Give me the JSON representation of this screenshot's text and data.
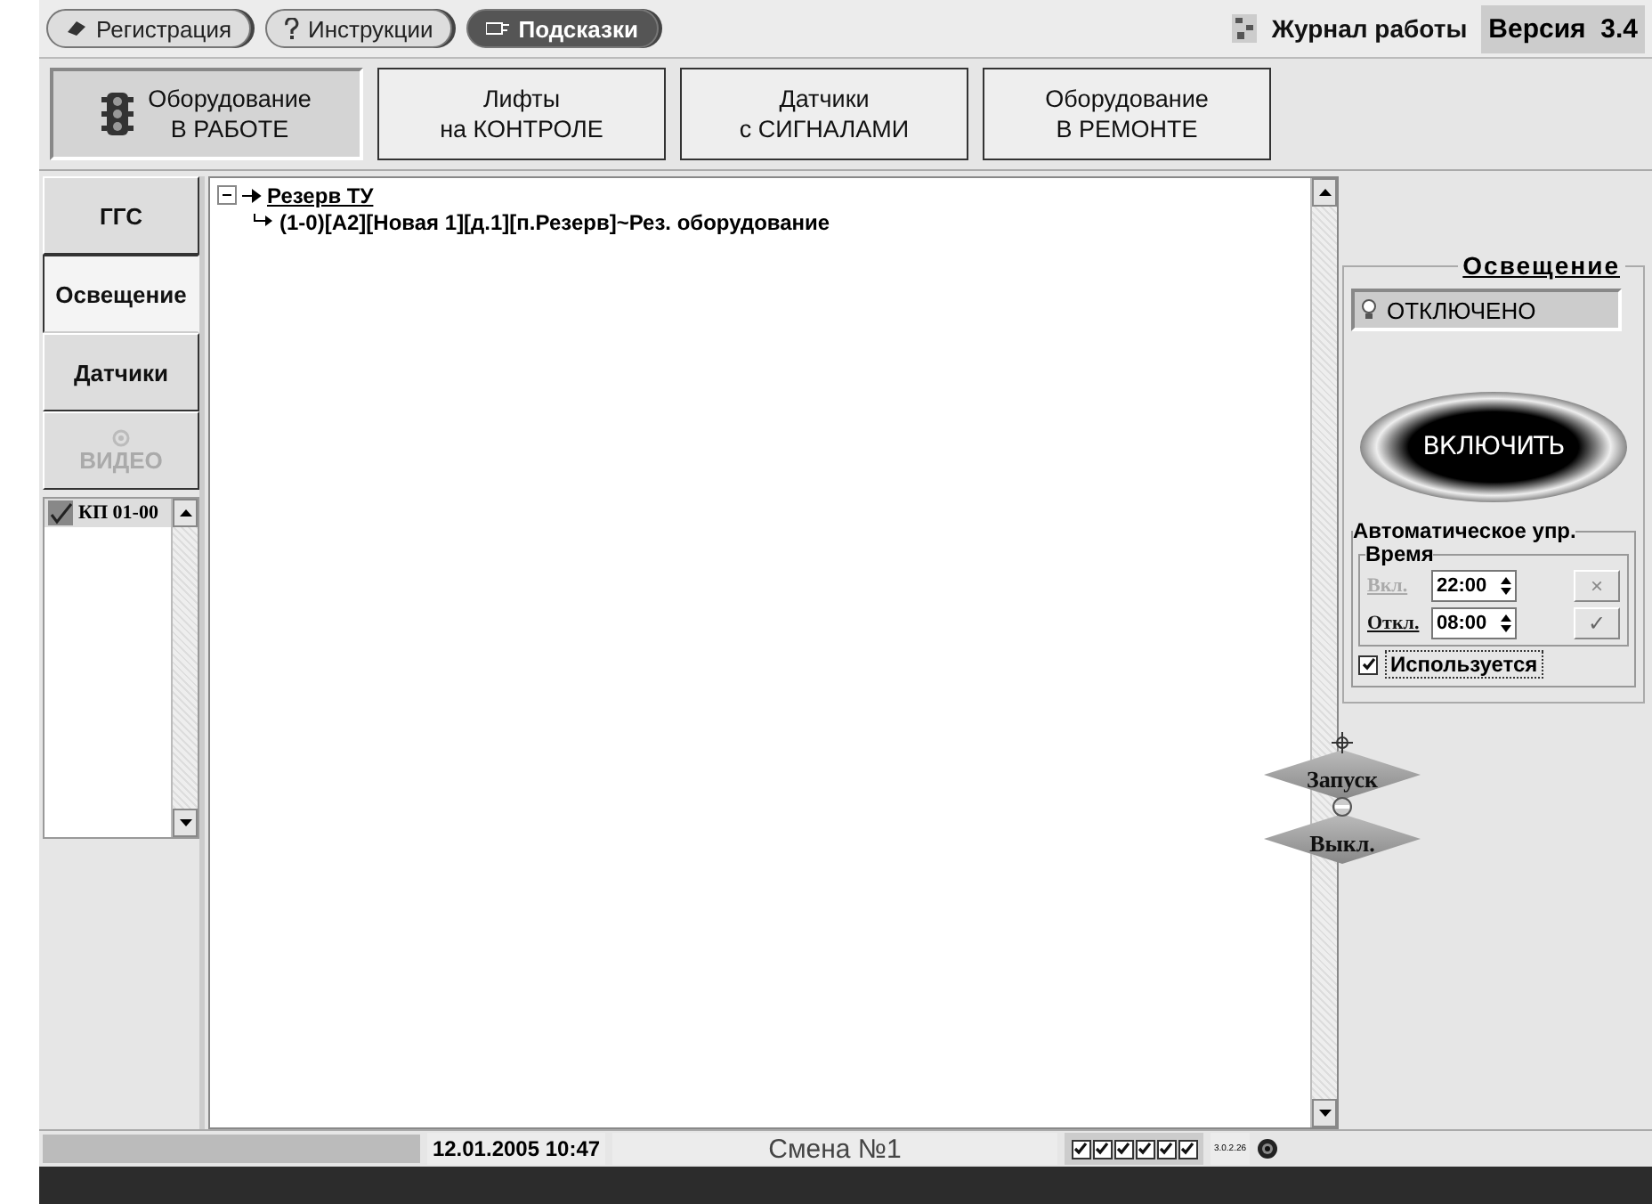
{
  "top_bar": {
    "buttons": [
      {
        "label": "Регистрация",
        "kind": "register",
        "selected": false
      },
      {
        "label": "Инструкции",
        "kind": "help",
        "selected": false
      },
      {
        "label": "Подсказки",
        "kind": "hints",
        "selected": true
      }
    ],
    "journal": "Журнал работы",
    "version": "Версия  3.4"
  },
  "nav": [
    {
      "lines": [
        "Оборудование",
        "В РАБОТЕ"
      ],
      "selected": true
    },
    {
      "lines": [
        "Лифты",
        "на КОНТРОЛЕ"
      ],
      "selected": false
    },
    {
      "lines": [
        "Датчики",
        "с СИГНАЛАМИ"
      ],
      "selected": false
    },
    {
      "lines": [
        "Оборудование",
        "В РЕМОНТЕ"
      ],
      "selected": false
    }
  ],
  "side_tabs": [
    {
      "label": "ГГС",
      "selected": false,
      "disabled": false
    },
    {
      "label": "Освещение",
      "selected": true,
      "disabled": false
    },
    {
      "label": "Датчики",
      "selected": false,
      "disabled": false
    },
    {
      "label": "ВИДЕО",
      "selected": false,
      "disabled": true
    }
  ],
  "kp_list": [
    {
      "label": "КП 01-00",
      "checked": true
    }
  ],
  "tree": [
    {
      "label": "Резерв ТУ",
      "expanded": true,
      "children": [
        {
          "label": "(1-0)[А2][Новая 1][д.1][п.Резерв]~Рез. оборудование"
        }
      ]
    }
  ],
  "lighting": {
    "title": "Освещение",
    "status": "ОТКЛЮЧЕНО",
    "button": "ВКЛЮЧИТЬ",
    "auto": {
      "title": "Автоматическое упр.",
      "time_title": "Время",
      "rows": [
        {
          "label": "Вкл.",
          "value": "22:00",
          "disabled": true,
          "action": "×"
        },
        {
          "label": "Откл.",
          "value": "08:00",
          "disabled": false,
          "action": "✓"
        }
      ],
      "used": {
        "label": "Используется",
        "checked": true
      }
    }
  },
  "floating": [
    {
      "label": "Запуск",
      "kind": "start"
    },
    {
      "label": "Выкл.",
      "kind": "stop"
    }
  ],
  "status_bar": {
    "date": "12.01.2005 10:47",
    "shift": "Смена №1",
    "checks": [
      {
        "checked": true
      },
      {
        "checked": true
      },
      {
        "checked": true
      },
      {
        "checked": true
      },
      {
        "checked": true
      },
      {
        "checked": true
      }
    ],
    "build": "3.0.2.26"
  }
}
